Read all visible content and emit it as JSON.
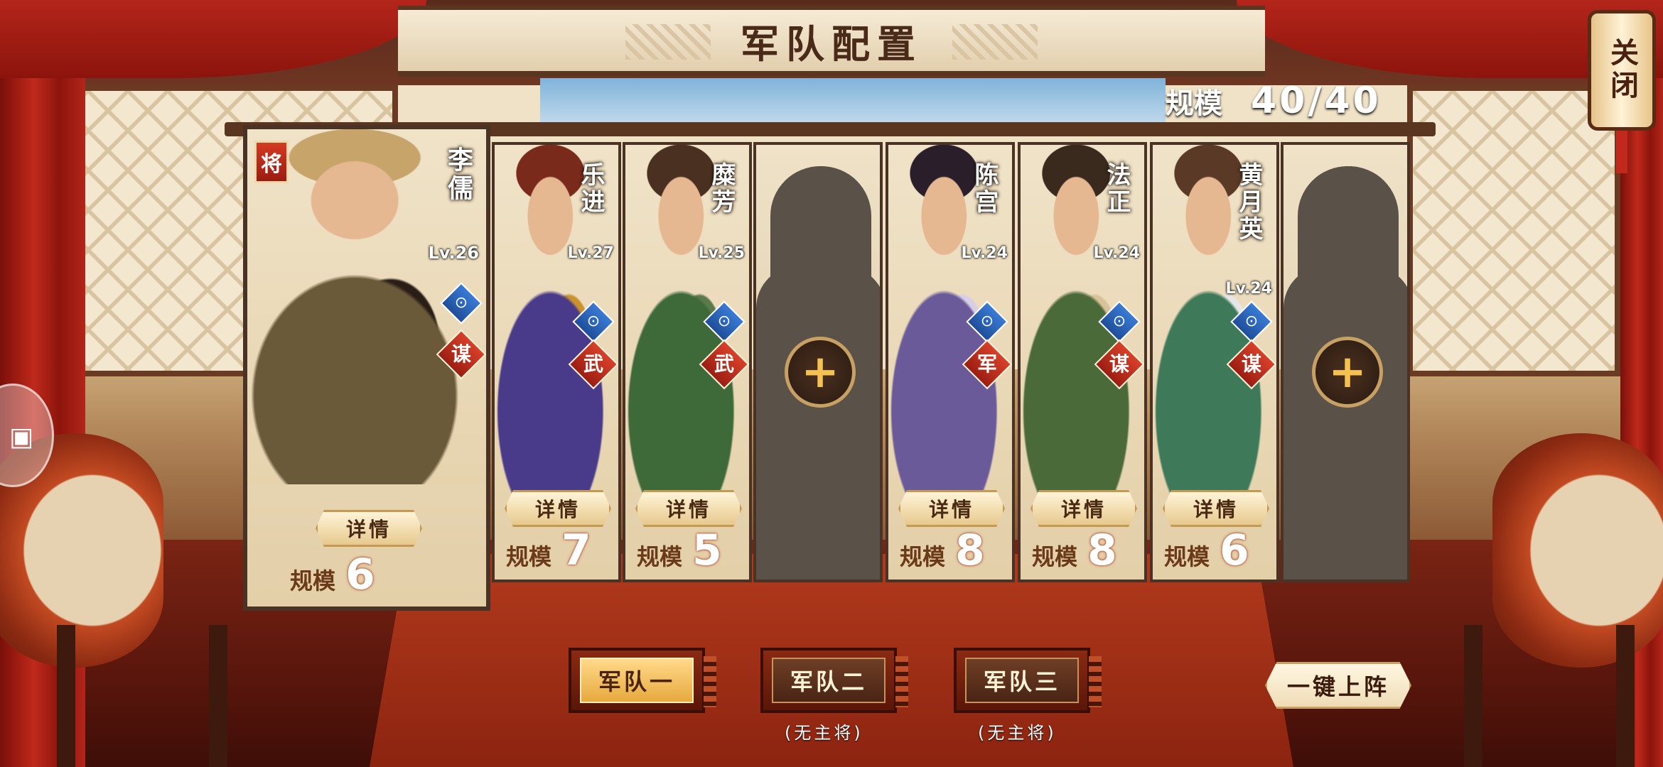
{
  "title": "军队配置",
  "scale_total": {
    "label": "规模",
    "value": "40/40"
  },
  "close_label": "关闭",
  "leader_flag": "将",
  "detail_label": "详情",
  "scale_label": "规模",
  "generals": [
    {
      "name": "李儒",
      "level": "Lv.26",
      "type": "谋",
      "scale": "6",
      "leader": true,
      "colors": [
        "#6b5a3a",
        "#2a1e16",
        "#c7a46a"
      ]
    },
    {
      "name": "乐进",
      "level": "Lv.27",
      "type": "武",
      "scale": "7",
      "colors": [
        "#4a3a8a",
        "#c9922e",
        "#7a2a1a"
      ]
    },
    {
      "name": "糜芳",
      "level": "Lv.25",
      "type": "武",
      "scale": "5",
      "colors": [
        "#3e6a3a",
        "#5a7a4a",
        "#4a3020"
      ]
    },
    {
      "name": "陈宫",
      "level": "Lv.24",
      "type": "军",
      "scale": "8",
      "colors": [
        "#6a5a9a",
        "#d8cfe6",
        "#2a1e2a"
      ]
    },
    {
      "name": "法正",
      "level": "Lv.24",
      "type": "谋",
      "scale": "8",
      "colors": [
        "#4a6a3a",
        "#d8c29a",
        "#3a2a1e"
      ]
    },
    {
      "name": "黄月英",
      "level": "Lv.24",
      "type": "谋",
      "scale": "6",
      "colors": [
        "#3e7a5a",
        "#e6e6e6",
        "#5a3a26"
      ]
    }
  ],
  "icons": {
    "horse": "horse-icon",
    "add": "plus-icon",
    "lock": "lock-icon"
  },
  "army_tabs": [
    {
      "label": "军队一",
      "note": "",
      "active": true
    },
    {
      "label": "军队二",
      "note": "(无主将)"
    },
    {
      "label": "军队三",
      "note": "(无主将)"
    }
  ],
  "one_key_label": "一键上阵"
}
